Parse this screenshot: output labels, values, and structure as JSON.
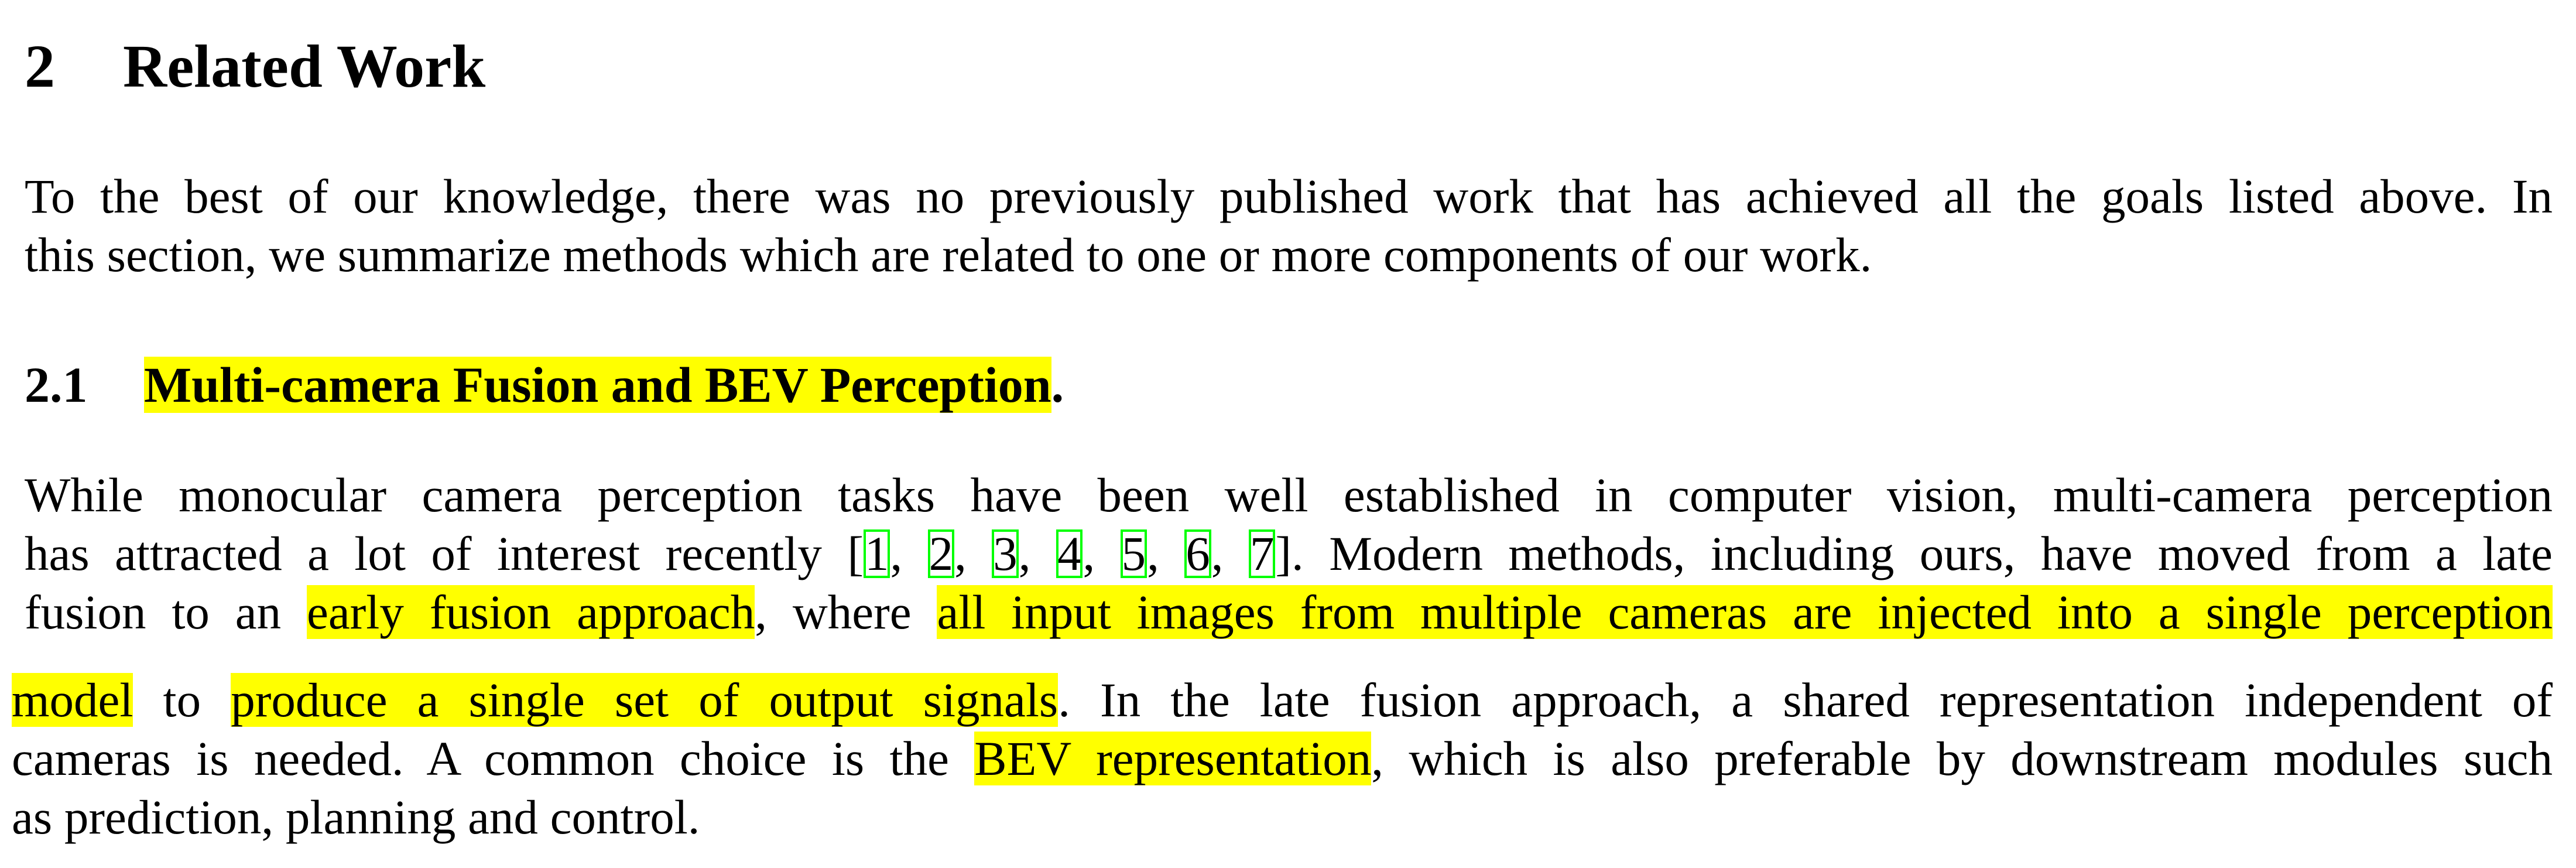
{
  "section": {
    "number": "2",
    "title": "Related Work"
  },
  "intro": {
    "line1": "To the best of our knowledge, there was no previously published work that has achieved all the goals listed above. In",
    "line2": "this section, we summarize methods which are related to one or more components of our work."
  },
  "subsection": {
    "number": "2.1",
    "title": "Multi-camera Fusion and BEV Perception",
    "title_end": "."
  },
  "para": {
    "l1": "While monocular camera perception tasks have been well established in computer vision, multi-camera perception",
    "l2_pre": "has attracted a lot of interest recently [",
    "citations": [
      "1",
      "2",
      "3",
      "4",
      "5",
      "6",
      "7"
    ],
    "sep": ", ",
    "l2_post": "]. Modern methods, including ours, have moved from a late",
    "l3_a": "fusion to an ",
    "l3_hl1": "early fusion approach",
    "l3_b": ", where ",
    "l3_hl2": "all input images from multiple cameras are injected into a single perception",
    "l4_hl1": "model",
    "l4_a": " to ",
    "l4_hl2": "produce a single set of output signals",
    "l4_b": ". In the late fusion approach, a shared representation independent of",
    "l5_a": "cameras is needed. A common choice is the ",
    "l5_hl": "BEV representation",
    "l5_b": ", which is also preferable by downstream modules such",
    "l6": "as prediction, planning and control."
  },
  "colors": {
    "highlight": "#ffff00",
    "citation_box": "#00ff00",
    "text": "#000000"
  }
}
